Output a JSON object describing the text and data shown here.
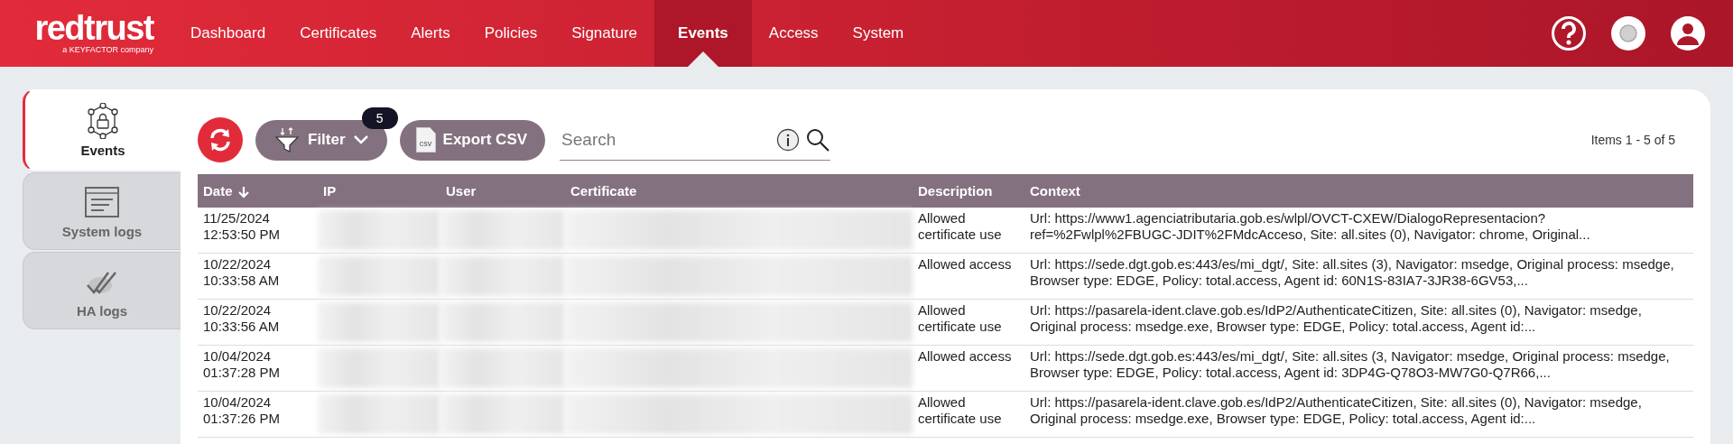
{
  "header": {
    "logo": {
      "name": "redtrust",
      "tagline": "a KEYFACTOR company"
    },
    "nav": [
      {
        "label": "Dashboard",
        "selected": false
      },
      {
        "label": "Certificates",
        "selected": false
      },
      {
        "label": "Alerts",
        "selected": false
      },
      {
        "label": "Policies",
        "selected": false
      },
      {
        "label": "Signature",
        "selected": false
      },
      {
        "label": "Events",
        "selected": true
      },
      {
        "label": "Access",
        "selected": false
      },
      {
        "label": "System",
        "selected": false
      }
    ]
  },
  "side_tabs": [
    {
      "label": "Events",
      "kind": "events",
      "selected": true
    },
    {
      "label": "System logs",
      "kind": "system",
      "selected": false
    },
    {
      "label": "HA logs",
      "kind": "ha",
      "selected": false
    }
  ],
  "toolbar": {
    "filter": {
      "label": "Filter",
      "badge": "5"
    },
    "export": {
      "label": "Export CSV",
      "icon_text": "csv"
    },
    "search": {
      "placeholder": "Search"
    },
    "pager": "Items 1 - 5 of 5"
  },
  "table": {
    "columns": [
      {
        "label": "Date",
        "sorted": true
      },
      {
        "label": "IP",
        "sorted": false
      },
      {
        "label": "User",
        "sorted": false
      },
      {
        "label": "Certificate",
        "sorted": false
      },
      {
        "label": "Description",
        "sorted": false
      },
      {
        "label": "Context",
        "sorted": false
      }
    ],
    "rows": [
      {
        "date": "11/25/2024 12:53:50 PM",
        "description": "Allowed certificate use",
        "context": "Url: https://www1.agenciatributaria.gob.es/wlpl/OVCT-CXEW/DialogoRepresentacion?ref=%2Fwlpl%2FBUGC-JDIT%2FMdcAcceso, Site: all.sites (0), Navigator: chrome, Original..."
      },
      {
        "date": "10/22/2024 10:33:58 AM",
        "description": "Allowed access",
        "context": "Url: https://sede.dgt.gob.es:443/es/mi_dgt/, Site: all.sites (3), Navigator: msedge, Original process: msedge, Browser type: EDGE, Policy: total.access, Agent id: 60N1S-83IA7-3JR38-6GV53,..."
      },
      {
        "date": "10/22/2024 10:33:56 AM",
        "description": "Allowed certificate use",
        "context": "Url: https://pasarela-ident.clave.gob.es/IdP2/AuthenticateCitizen, Site: all.sites (0), Navigator: msedge, Original process: msedge.exe, Browser type: EDGE, Policy: total.access, Agent id:..."
      },
      {
        "date": "10/04/2024 01:37:28 PM",
        "description": "Allowed access",
        "context": "Url: https://sede.dgt.gob.es:443/es/mi_dgt/, Site: all.sites (3, Navigator: msedge, Original process: msedge, Browser type: EDGE, Policy: total.access, Agent id: 3DP4G-Q78O3-MW7G0-Q7R66,..."
      },
      {
        "date": "10/04/2024 01:37:26 PM",
        "description": "Allowed certificate use",
        "context": "Url: https://pasarela-ident.clave.gob.es/IdP2/AuthenticateCitizen, Site: all.sites (0), Navigator: msedge, Original process: msedge.exe, Browser type: EDGE, Policy: total.access, Agent id:..."
      }
    ]
  }
}
